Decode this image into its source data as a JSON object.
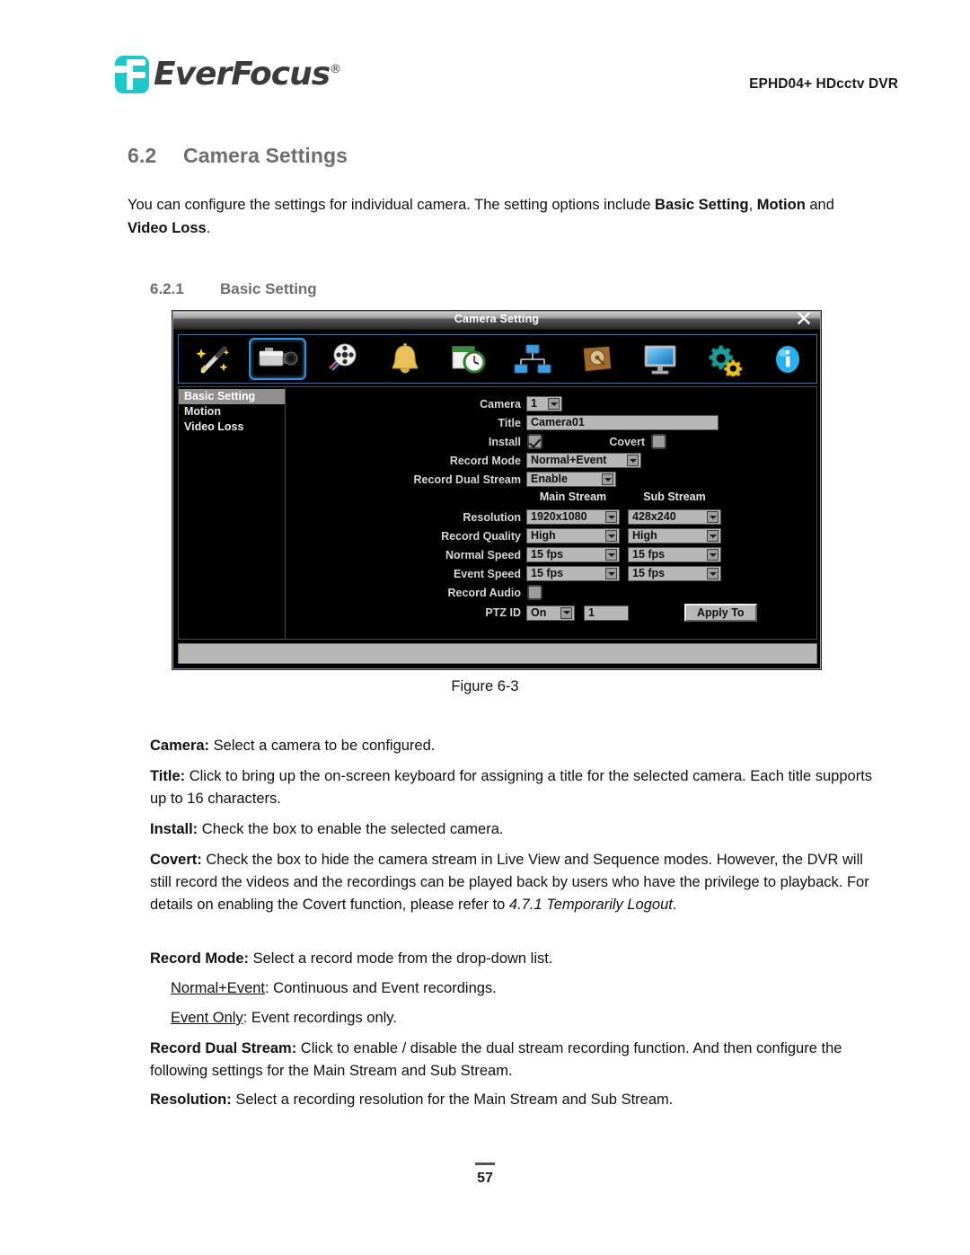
{
  "header": {
    "logo_text": "EverFocus",
    "logo_registered": "®",
    "model": "EPHD04+  HDcctv DVR"
  },
  "section": {
    "number": "6.2",
    "title": "Camera Settings",
    "intro_html": "You can configure the settings for individual camera. The setting options include <b>Basic Setting</b>, <b>Motion</b> and <b>Video Loss</b>."
  },
  "subsection": {
    "number": "6.2.1",
    "title": "Basic Setting"
  },
  "dialog": {
    "title": "Camera Setting",
    "close_icon": "close-icon",
    "toolbar_icons": [
      {
        "name": "wizard-icon",
        "selected": false
      },
      {
        "name": "camera-icon",
        "selected": true
      },
      {
        "name": "film-reel-icon",
        "selected": false
      },
      {
        "name": "bell-icon",
        "selected": false
      },
      {
        "name": "schedule-clock-icon",
        "selected": false
      },
      {
        "name": "network-icon",
        "selected": false
      },
      {
        "name": "disk-icon",
        "selected": false
      },
      {
        "name": "monitor-icon",
        "selected": false
      },
      {
        "name": "gears-icon",
        "selected": false
      },
      {
        "name": "info-icon",
        "selected": false
      }
    ],
    "sidebar": [
      {
        "label": "Basic Setting",
        "active": true
      },
      {
        "label": "Motion",
        "active": false
      },
      {
        "label": "Video Loss",
        "active": false
      }
    ],
    "form": {
      "camera_label": "Camera",
      "camera_value": "1",
      "title_label": "Title",
      "title_value": "Camera01",
      "install_label": "Install",
      "install_checked": true,
      "covert_label": "Covert",
      "covert_checked": false,
      "record_mode_label": "Record Mode",
      "record_mode_value": "Normal+Event",
      "record_dual_stream_label": "Record Dual Stream",
      "record_dual_stream_value": "Enable",
      "main_stream_header": "Main Stream",
      "sub_stream_header": "Sub Stream",
      "resolution_label": "Resolution",
      "resolution_main": "1920x1080",
      "resolution_sub": "428x240",
      "record_quality_label": "Record Quality",
      "record_quality_main": "High",
      "record_quality_sub": "High",
      "normal_speed_label": "Normal Speed",
      "normal_speed_main": "15 fps",
      "normal_speed_sub": "15 fps",
      "event_speed_label": "Event Speed",
      "event_speed_main": "15 fps",
      "event_speed_sub": "15 fps",
      "record_audio_label": "Record Audio",
      "record_audio_checked": false,
      "ptz_id_label": "PTZ ID",
      "ptz_id_enabled": "On",
      "ptz_id_value": "1",
      "apply_to_label": "Apply To"
    }
  },
  "figure_caption": "Figure 6-3",
  "descriptions": [
    {
      "html": "<b>Camera:</b> Select a camera to be configured.",
      "indent": false
    },
    {
      "html": "<b>Title:</b> Click to bring up the on-screen keyboard for assigning a title for the selected camera. Each title supports up to 16 characters.",
      "indent": false
    },
    {
      "html": "<b>Install:</b> Check the box to enable the selected camera.",
      "indent": false
    },
    {
      "html": "<b>Covert:</b> Check the box to hide the camera stream in Live View and Sequence modes. However, the DVR will still record the videos and the recordings can be played back by users who have the privilege to playback. For details on enabling the Covert function, please refer to <span class=\"i\">4.7.1 Temporarily Logout</span>.",
      "indent": false
    },
    {
      "html": "<b>Record Mode:</b> Select a record mode from the drop-down list.",
      "indent": false
    },
    {
      "html": "<span class=\"u\">Normal+Event</span>: Continuous and Event recordings.",
      "indent": true
    },
    {
      "html": "<span class=\"u\">Event Only</span>: Event recordings only.",
      "indent": true
    },
    {
      "html": "<b>Record Dual Stream:</b> Click to enable / disable the dual stream recording function. And then configure the following settings for the Main Stream and Sub Stream.",
      "indent": false
    },
    {
      "html": "<b>Resolution:</b> Select a recording resolution for the Main Stream and Sub Stream.",
      "indent": false
    }
  ],
  "footer": {
    "page_number": "57"
  },
  "colors": {
    "brand_teal": "#1ec8c8",
    "heading_gray": "#6e6e6e",
    "dialog_control_gray": "#b7b7b7",
    "selected_icon_blue": "#3a8fd0"
  }
}
